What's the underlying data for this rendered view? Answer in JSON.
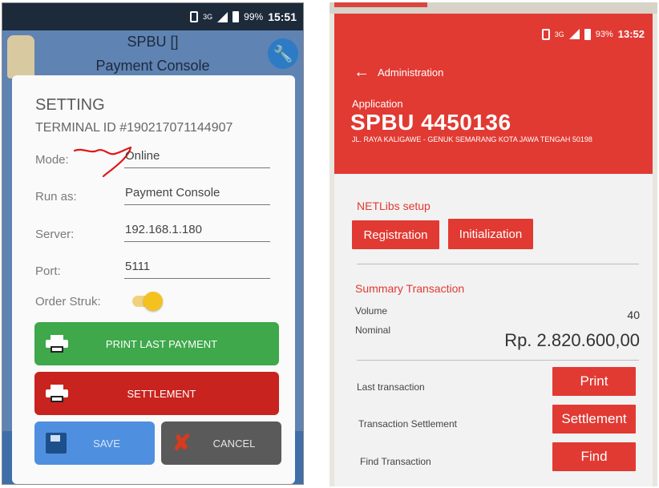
{
  "left_screen": {
    "status_bar": {
      "network": "3G",
      "battery": "99%",
      "time": "15:51"
    },
    "app_header": {
      "title_line1": "SPBU []",
      "title_line2": "Payment Console"
    },
    "dialog": {
      "title": "SETTING",
      "terminal_id": "TERMINAL ID #190217071144907",
      "fields": [
        {
          "label": "Mode:",
          "value": "Online"
        },
        {
          "label": "Run as:",
          "value": "Payment Console"
        },
        {
          "label": "Server:",
          "value": "192.168.1.180"
        },
        {
          "label": "Port:",
          "value": "5111"
        }
      ],
      "toggle": {
        "label": "Order Struk:",
        "state": "on"
      },
      "buttons": {
        "print_last_payment": "PRINT LAST PAYMENT",
        "settlement": "SETTLEMENT",
        "save": "SAVE",
        "cancel": "CANCEL"
      }
    }
  },
  "right_screen": {
    "status_bar": {
      "network": "3G",
      "battery": "93%",
      "time": "13:52"
    },
    "header": {
      "nav_title": "Administration",
      "app_label": "Application",
      "app_name": "SPBU 4450136",
      "address": "JL. RAYA KALIGAWE - GENUK SEMARANG KOTA JAWA TENGAH 50198"
    },
    "netlibs": {
      "title": "NETLibs setup",
      "registration": "Registration",
      "initialization": "Initialization"
    },
    "summary": {
      "title": "Summary Transaction",
      "volume_label": "Volume",
      "volume_value": "40",
      "nominal_label": "Nominal",
      "nominal_value": "Rp. 2.820.600,00"
    },
    "actions": [
      {
        "label": "Last transaction",
        "button": "Print"
      },
      {
        "label": "Transaction Settlement",
        "button": "Settlement"
      },
      {
        "label": "Find Transaction",
        "button": "Find"
      }
    ]
  },
  "colors": {
    "red_accent": "#e13a33",
    "green_button": "#3ea84a",
    "settlement_red": "#c8231f",
    "save_blue": "#4f8fe0",
    "cancel_gray": "#5a5a5a",
    "toggle_yellow": "#f4c21f"
  },
  "icons": [
    "wrench-icon",
    "printer-icon",
    "save-disk-icon",
    "cancel-x-icon",
    "back-arrow-icon",
    "signal-icon",
    "battery-icon"
  ]
}
